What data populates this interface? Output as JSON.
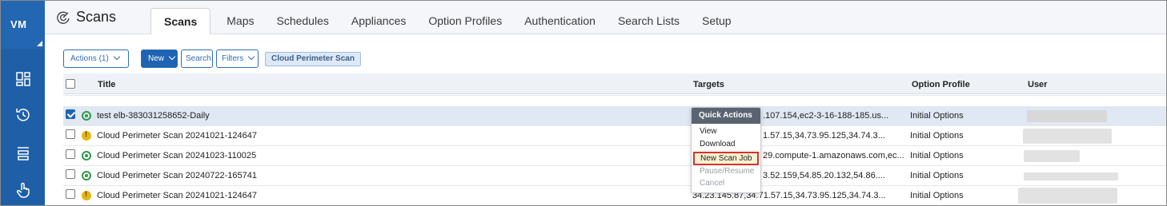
{
  "sidebar": {
    "logo": "VM",
    "icons": [
      "dashboard-icon",
      "history-icon",
      "list-icon",
      "touch-icon"
    ]
  },
  "header": {
    "title": "Scans",
    "tabs": [
      {
        "label": "Scans",
        "active": true
      },
      {
        "label": "Maps"
      },
      {
        "label": "Schedules"
      },
      {
        "label": "Appliances"
      },
      {
        "label": "Option Profiles"
      },
      {
        "label": "Authentication"
      },
      {
        "label": "Search Lists"
      },
      {
        "label": "Setup"
      }
    ]
  },
  "toolbar": {
    "actions_label": "Actions (1)",
    "new_label": "New",
    "search_label": "Search",
    "filters_label": "Filters",
    "filter_chip": "Cloud Perimeter Scan"
  },
  "table": {
    "columns": {
      "title": "Title",
      "targets": "Targets",
      "option_profile": "Option Profile",
      "user": "User"
    },
    "rows": [
      {
        "title": "test elb-383031258652-Daily",
        "targets": ".107.154,ec2-3-16-188-185.us...",
        "option_profile": "Initial Options",
        "status": "ok",
        "checked": true
      },
      {
        "title": "Cloud Perimeter Scan 20241021-124647",
        "targets": "1.57.15,34.73.95.125,34.74.3...",
        "option_profile": "Initial Options",
        "status": "warn",
        "checked": false
      },
      {
        "title": "Cloud Perimeter Scan 20241023-110025",
        "targets": "29.compute-1.amazonaws.com,ec...",
        "option_profile": "Initial Options",
        "status": "ok",
        "checked": false
      },
      {
        "title": "Cloud Perimeter Scan 20240722-165741",
        "targets": "3.52.159,54.85.20.132,54.86....",
        "option_profile": "Initial Options",
        "status": "ok",
        "checked": false
      },
      {
        "title": "Cloud Perimeter Scan 20241021-124647",
        "targets": "34.23.145.87,34.71.57.15,34.73.95.125,34.74.3...",
        "option_profile": "Initial Options",
        "status": "warn",
        "checked": false
      }
    ]
  },
  "quick_actions": {
    "title": "Quick Actions",
    "items": [
      {
        "label": "View"
      },
      {
        "label": "Download"
      },
      {
        "label": "New Scan Job"
      },
      {
        "label": "Pause/Resume"
      },
      {
        "label": "Cancel"
      }
    ]
  }
}
